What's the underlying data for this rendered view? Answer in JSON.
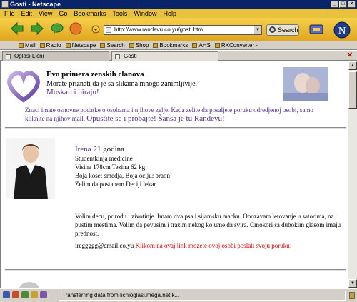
{
  "window": {
    "title": "Gosti - Netscape"
  },
  "menu": [
    "File",
    "Edit",
    "View",
    "Go",
    "Bookmarks",
    "Tools",
    "Window",
    "Help"
  ],
  "toolbar": {
    "url": "http://www.randevu.co.yu/gosti.htm",
    "search_label": "Search"
  },
  "personal_toolbar": [
    "Mail",
    "Radio",
    "Netscape",
    "Search",
    "Shop",
    "Bookmarks",
    "AHS",
    "RXConverter -"
  ],
  "tabs": [
    {
      "label": "Oglasi Licni",
      "active": false
    },
    {
      "label": "Gosti",
      "active": true
    }
  ],
  "header": {
    "title": "Evo primera zenskih clanova",
    "subtitle": "Morate priznati da je sa slikama mnogo zanimljivije.",
    "link": "Muskarci birajuǃ"
  },
  "intro": {
    "text": "Znaci imate osnovne podatke o osobama i njihove zelje. Kada zelite da posaljete poruku odredjenoj osobi, samo kliknite na njihov mail.",
    "strong": "Opustite se i probajte! Šansa je tu Randevu!"
  },
  "profile": {
    "name": "Irena",
    "age": "21 godina",
    "lines": [
      "Studentkinja medicine",
      "Visina 178cm Tezina 62 kg",
      "Boja kose: smedja, Boja ociju: braon",
      "Zelim da postanem Deciji lekar"
    ],
    "description": "Volim decu, prirodu i zivotinje. Imam dva psa i sijamsku macku. Obozavam letovanje u satorima, na pustim mestima. Volim da pevusim i trazim nekog ko ume da svira. Cmokori sa dubokim glasom imaju prednost.",
    "email": "ireggggg@email.co.yu",
    "email_link": "Klikom na ovaj link mozete ovoj osobi poslati svoju poruku!"
  },
  "status": {
    "text": "Transferring data from licnioglasi.mega.net.k..."
  },
  "colors": {
    "title_bar": "#0a246a",
    "menu_bar": "#e8c23c",
    "link_purple": "#4e2a86",
    "link_red": "#d00000"
  }
}
